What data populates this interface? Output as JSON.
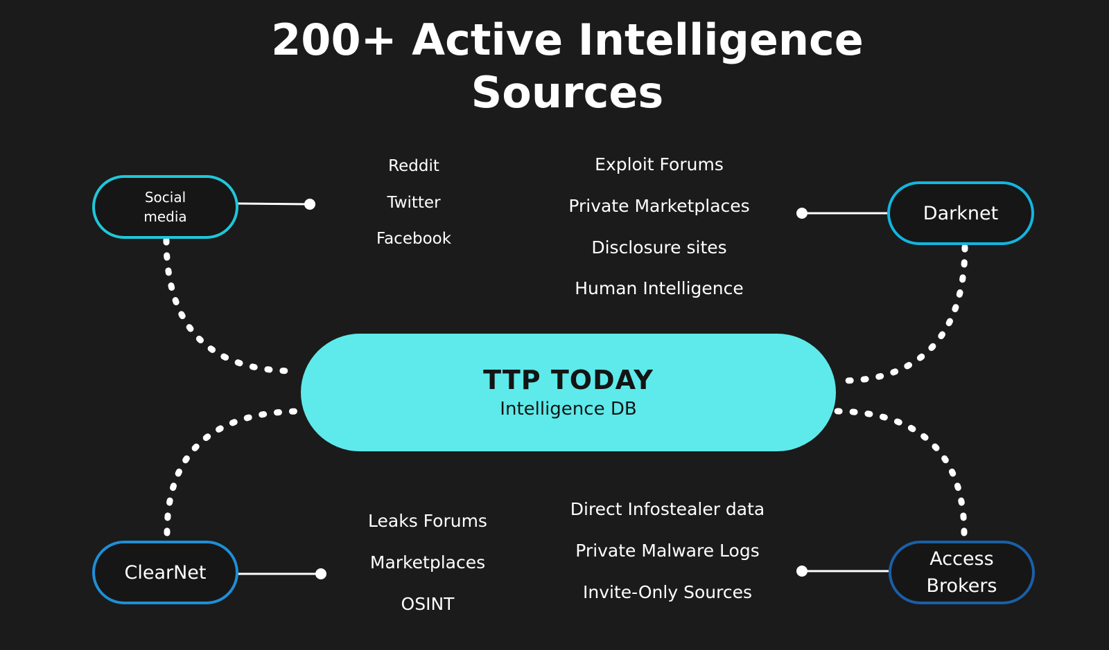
{
  "title": {
    "line1": "200+ Active Intelligence",
    "line2": "Sources"
  },
  "hub": {
    "name": "TTP TODAY",
    "subtitle": "Intelligence DB"
  },
  "nodes": {
    "social_media": {
      "label": "Social\nmedia",
      "sources": [
        "Reddit",
        "Twitter",
        "Facebook"
      ]
    },
    "darknet": {
      "label": "Darknet",
      "sources": [
        "Exploit Forums",
        "Private Marketplaces",
        "Disclosure sites",
        "Human Intelligence"
      ]
    },
    "clearnet": {
      "label": "ClearNet",
      "sources": [
        "Leaks Forums",
        "Marketplaces",
        "OSINT"
      ]
    },
    "access_brokers": {
      "label": "Access\nBrokers",
      "sources": [
        "Direct Infostealer data",
        "Private Malware Logs",
        "Invite-Only Sources"
      ]
    }
  },
  "colors": {
    "background": "#1b1b1b",
    "hub_fill": "#5eeaea",
    "social_media_border": "#1fc8d8",
    "darknet_border": "#12b6e0",
    "clearnet_border": "#1e8fd6",
    "access_brokers_border": "#1a5fa8",
    "connector": "#ffffff"
  }
}
